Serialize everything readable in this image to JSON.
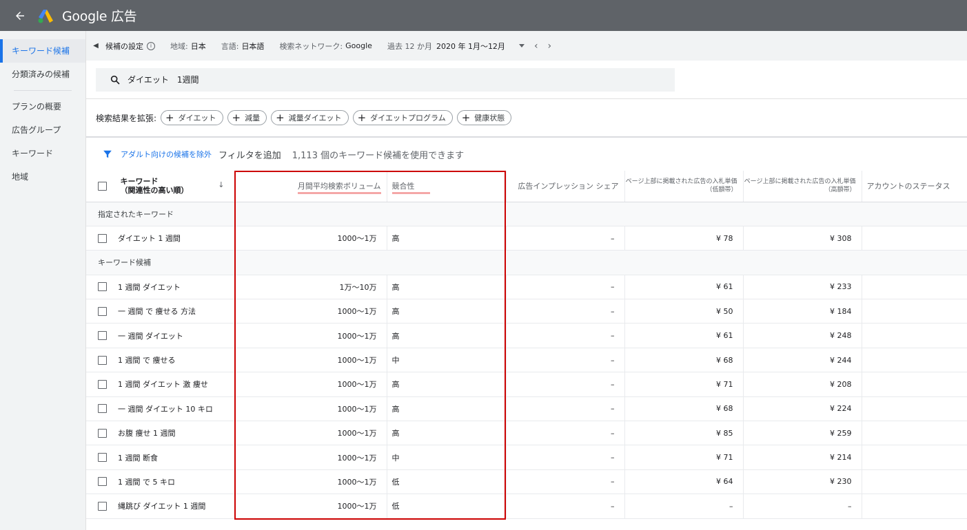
{
  "header": {
    "title": "Google 広告"
  },
  "sidebar": {
    "items": [
      "キーワード候補",
      "分類済みの候補",
      "プランの概要",
      "広告グループ",
      "キーワード",
      "地域"
    ]
  },
  "settings": {
    "label": "候補の設定",
    "region_label": "地域:",
    "region": "日本",
    "lang_label": "言語:",
    "lang": "日本語",
    "network_label": "検索ネットワーク:",
    "network": "Google",
    "period_label": "過去 12 か月",
    "period": "2020 年 1月～12月"
  },
  "search": {
    "query": "ダイエット　1週間"
  },
  "expand": {
    "label": "検索結果を拡張:",
    "chips": [
      "ダイエット",
      "減量",
      "減量ダイエット",
      "ダイエットプログラム",
      "健康状態"
    ]
  },
  "filter": {
    "exclude_adult": "アダルト向けの候補を除外",
    "add_filter": "フィルタを追加",
    "count_text": "1,113 個のキーワード候補を使用できます"
  },
  "table": {
    "headers": {
      "keyword": "キーワード",
      "keyword_sub": "（関連性の高い順）",
      "volume": "月間平均検索ボリューム",
      "competition": "競合性",
      "impression_share": "広告インプレッション シェア",
      "bid_low": "ページ上部に掲載された広告の入札単価（低額帯）",
      "bid_high": "ページ上部に掲載された広告の入札単価（高額帯）",
      "status": "アカウントのステータス"
    },
    "group_specified": "指定されたキーワード",
    "group_ideas": "キーワード候補",
    "specified": [
      {
        "keyword": "ダイエット 1 週間",
        "volume": "1000～1万",
        "competition": "高",
        "share": "–",
        "low": "¥ 78",
        "high": "¥ 308"
      }
    ],
    "ideas": [
      {
        "keyword": "1 週間 ダイエット",
        "volume": "1万～10万",
        "competition": "高",
        "share": "–",
        "low": "¥ 61",
        "high": "¥ 233"
      },
      {
        "keyword": "一 週間 で 痩せる 方法",
        "volume": "1000～1万",
        "competition": "高",
        "share": "–",
        "low": "¥ 50",
        "high": "¥ 184"
      },
      {
        "keyword": "一 週間 ダイエット",
        "volume": "1000～1万",
        "competition": "高",
        "share": "–",
        "low": "¥ 61",
        "high": "¥ 248"
      },
      {
        "keyword": "1 週間 で 痩せる",
        "volume": "1000～1万",
        "competition": "中",
        "share": "–",
        "low": "¥ 68",
        "high": "¥ 244"
      },
      {
        "keyword": "1 週間 ダイエット 激 痩せ",
        "volume": "1000～1万",
        "competition": "高",
        "share": "–",
        "low": "¥ 71",
        "high": "¥ 208"
      },
      {
        "keyword": "一 週間 ダイエット 10 キロ",
        "volume": "1000～1万",
        "competition": "高",
        "share": "–",
        "low": "¥ 68",
        "high": "¥ 224"
      },
      {
        "keyword": "お腹 痩せ 1 週間",
        "volume": "1000～1万",
        "competition": "高",
        "share": "–",
        "low": "¥ 85",
        "high": "¥ 259"
      },
      {
        "keyword": "1 週間 断食",
        "volume": "1000～1万",
        "competition": "中",
        "share": "–",
        "low": "¥ 71",
        "high": "¥ 214"
      },
      {
        "keyword": "1 週間 で 5 キロ",
        "volume": "1000～1万",
        "competition": "低",
        "share": "–",
        "low": "¥ 64",
        "high": "¥ 230"
      },
      {
        "keyword": "縄跳び ダイエット 1 週間",
        "volume": "1000～1万",
        "competition": "低",
        "share": "–",
        "low": "–",
        "high": "–"
      }
    ]
  }
}
